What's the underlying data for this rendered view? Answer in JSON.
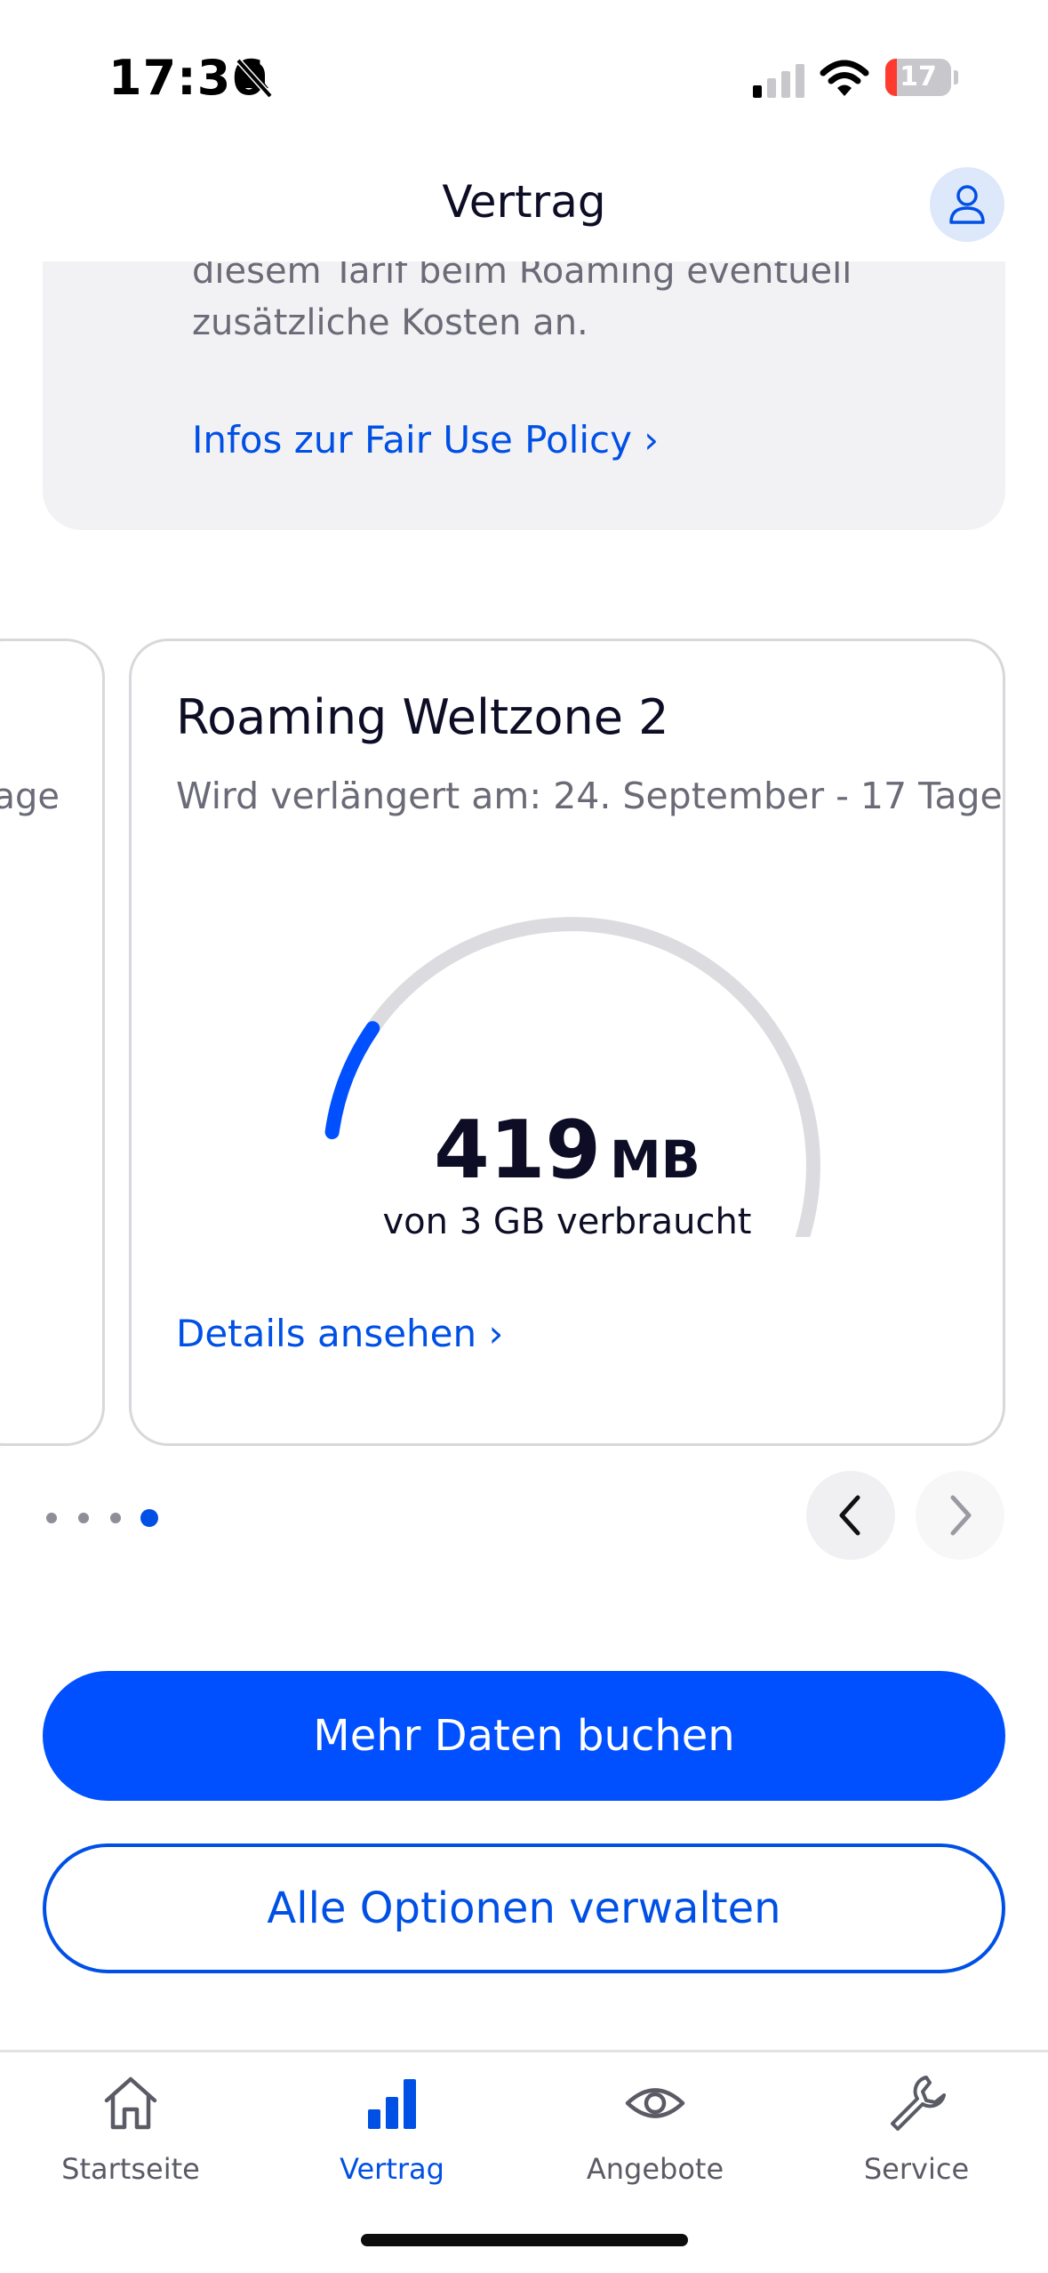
{
  "status_bar": {
    "time": "17:36",
    "battery_level": "17",
    "icons": [
      "bell-slash-icon",
      "cellular-signal-icon",
      "wifi-icon",
      "battery-icon"
    ]
  },
  "header": {
    "title": "Vertrag",
    "profile_icon": "person-icon"
  },
  "info_card": {
    "line1": "diesem Tarif beim Roaming eventuell",
    "line2": "zusätzliche Kosten an.",
    "link": "Infos zur Fair Use Policy ›"
  },
  "carousel": {
    "prev_card_fragment": "age",
    "card": {
      "title": "Roaming Weltzone 2",
      "subtitle": "Wird verlängert am: 24. September - 17 Tage",
      "usage_value": "419",
      "usage_unit": "MB",
      "usage_caption": "von 3 GB verbraucht",
      "used_fraction": 0.136,
      "details_link": "Details ansehen ›"
    },
    "pagination": {
      "count": 4,
      "active_index": 3
    },
    "prev_icon": "chevron-left-icon",
    "next_icon": "chevron-right-icon"
  },
  "actions": {
    "primary": "Mehr Daten buchen",
    "secondary": "Alle Optionen verwalten"
  },
  "tabbar": {
    "items": [
      {
        "label": "Startseite",
        "icon": "home-icon",
        "active": false
      },
      {
        "label": "Vertrag",
        "icon": "bar-chart-icon",
        "active": true
      },
      {
        "label": "Angebote",
        "icon": "eye-icon",
        "active": false
      },
      {
        "label": "Service",
        "icon": "wrench-icon",
        "active": false
      }
    ]
  },
  "colors": {
    "accent": "#0050e6",
    "primary_button": "#0050ff",
    "gauge_track": "#dcdce0",
    "battery_low": "#ff3b30"
  }
}
